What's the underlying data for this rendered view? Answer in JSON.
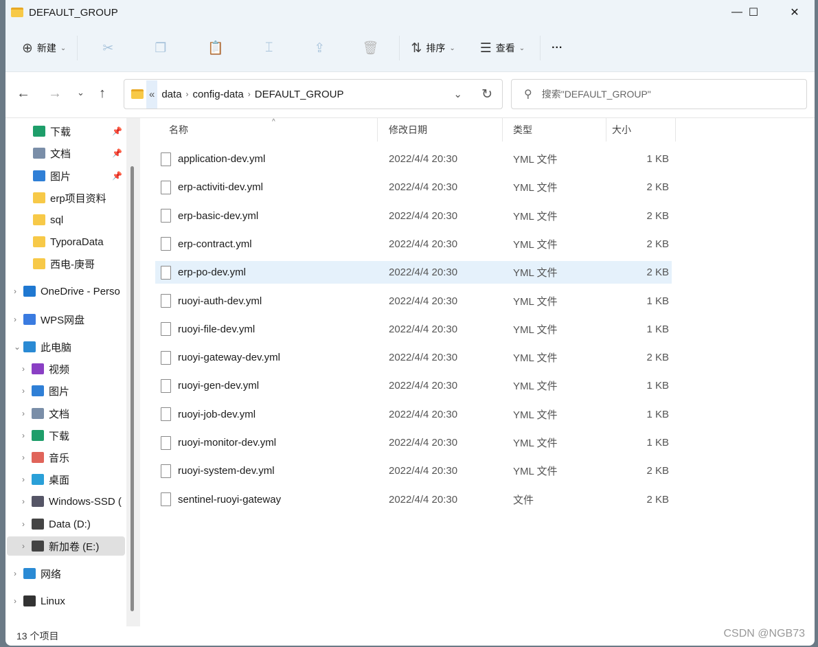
{
  "window": {
    "title": "DEFAULT_GROUP",
    "minimize": "—",
    "maximize": "☐",
    "close": "✕"
  },
  "toolbar": {
    "new_label": "新建",
    "sort_label": "排序",
    "view_label": "查看",
    "more": "···"
  },
  "nav": {
    "back": "←",
    "forward": "→",
    "recent": "⌄",
    "up": "↑",
    "overflow": "«",
    "crumbs": [
      "data",
      "config-data",
      "DEFAULT_GROUP"
    ],
    "refresh": "↻",
    "dropdown": "⌄"
  },
  "search": {
    "placeholder": "搜索\"DEFAULT_GROUP\""
  },
  "sidebar": {
    "items": [
      {
        "label": "下载",
        "icon": "download-icon",
        "color": "#1e9e6a",
        "pinned": true,
        "expand": false
      },
      {
        "label": "文档",
        "icon": "document-icon",
        "color": "#7a8ea8",
        "pinned": true,
        "expand": false
      },
      {
        "label": "图片",
        "icon": "pictures-icon",
        "color": "#2f7fd6",
        "pinned": true,
        "expand": false
      },
      {
        "label": "erp项目资料",
        "icon": "folder-icon",
        "color": "#f7c948",
        "pinned": false,
        "expand": false
      },
      {
        "label": "sql",
        "icon": "folder-icon",
        "color": "#f7c948",
        "pinned": false,
        "expand": false
      },
      {
        "label": "TyporaData",
        "icon": "folder-icon",
        "color": "#f7c948",
        "pinned": false,
        "expand": false
      },
      {
        "label": "西电-庚哥",
        "icon": "folder-icon",
        "color": "#f7c948",
        "pinned": false,
        "expand": false
      },
      {
        "label": "OneDrive - Perso",
        "icon": "onedrive-icon",
        "color": "#1f78d1",
        "pinned": false,
        "expand": true
      },
      {
        "label": "WPS网盘",
        "icon": "cloud-icon",
        "color": "#3a7be0",
        "pinned": false,
        "expand": true
      },
      {
        "label": "此电脑",
        "icon": "computer-icon",
        "color": "#2a8ad4",
        "pinned": false,
        "expand": true,
        "open": true
      },
      {
        "label": "视频",
        "icon": "video-icon",
        "color": "#8a3fc4",
        "pinned": false,
        "expand": true
      },
      {
        "label": "图片",
        "icon": "pictures-icon",
        "color": "#2f7fd6",
        "pinned": false,
        "expand": true
      },
      {
        "label": "文档",
        "icon": "document-icon",
        "color": "#7a8ea8",
        "pinned": false,
        "expand": true
      },
      {
        "label": "下载",
        "icon": "download-icon",
        "color": "#1e9e6a",
        "pinned": false,
        "expand": true
      },
      {
        "label": "音乐",
        "icon": "music-icon",
        "color": "#e0645a",
        "pinned": false,
        "expand": true
      },
      {
        "label": "桌面",
        "icon": "desktop-icon",
        "color": "#2aa0d8",
        "pinned": false,
        "expand": true
      },
      {
        "label": "Windows-SSD (",
        "icon": "drive-icon",
        "color": "#556",
        "pinned": false,
        "expand": true
      },
      {
        "label": "Data (D:)",
        "icon": "drive-icon",
        "color": "#444",
        "pinned": false,
        "expand": true
      },
      {
        "label": "新加卷 (E:)",
        "icon": "drive-icon",
        "color": "#444",
        "pinned": false,
        "expand": true,
        "selected": true
      },
      {
        "label": "网络",
        "icon": "network-icon",
        "color": "#2a8ad4",
        "pinned": false,
        "expand": true
      },
      {
        "label": "Linux",
        "icon": "linux-icon",
        "color": "#333",
        "pinned": false,
        "expand": true
      }
    ]
  },
  "columns": {
    "name": "名称",
    "date": "修改日期",
    "type": "类型",
    "size": "大小"
  },
  "files": [
    {
      "name": "application-dev.yml",
      "date": "2022/4/4 20:30",
      "type": "YML 文件",
      "size": "1 KB"
    },
    {
      "name": "erp-activiti-dev.yml",
      "date": "2022/4/4 20:30",
      "type": "YML 文件",
      "size": "2 KB"
    },
    {
      "name": "erp-basic-dev.yml",
      "date": "2022/4/4 20:30",
      "type": "YML 文件",
      "size": "2 KB"
    },
    {
      "name": "erp-contract.yml",
      "date": "2022/4/4 20:30",
      "type": "YML 文件",
      "size": "2 KB"
    },
    {
      "name": "erp-po-dev.yml",
      "date": "2022/4/4 20:30",
      "type": "YML 文件",
      "size": "2 KB",
      "selected": true
    },
    {
      "name": "ruoyi-auth-dev.yml",
      "date": "2022/4/4 20:30",
      "type": "YML 文件",
      "size": "1 KB"
    },
    {
      "name": "ruoyi-file-dev.yml",
      "date": "2022/4/4 20:30",
      "type": "YML 文件",
      "size": "1 KB"
    },
    {
      "name": "ruoyi-gateway-dev.yml",
      "date": "2022/4/4 20:30",
      "type": "YML 文件",
      "size": "2 KB"
    },
    {
      "name": "ruoyi-gen-dev.yml",
      "date": "2022/4/4 20:30",
      "type": "YML 文件",
      "size": "1 KB"
    },
    {
      "name": "ruoyi-job-dev.yml",
      "date": "2022/4/4 20:30",
      "type": "YML 文件",
      "size": "1 KB"
    },
    {
      "name": "ruoyi-monitor-dev.yml",
      "date": "2022/4/4 20:30",
      "type": "YML 文件",
      "size": "1 KB"
    },
    {
      "name": "ruoyi-system-dev.yml",
      "date": "2022/4/4 20:30",
      "type": "YML 文件",
      "size": "2 KB"
    },
    {
      "name": "sentinel-ruoyi-gateway",
      "date": "2022/4/4 20:30",
      "type": "文件",
      "size": "2 KB"
    }
  ],
  "status": {
    "count": "13 个项目"
  },
  "watermark": "CSDN @NGB73"
}
